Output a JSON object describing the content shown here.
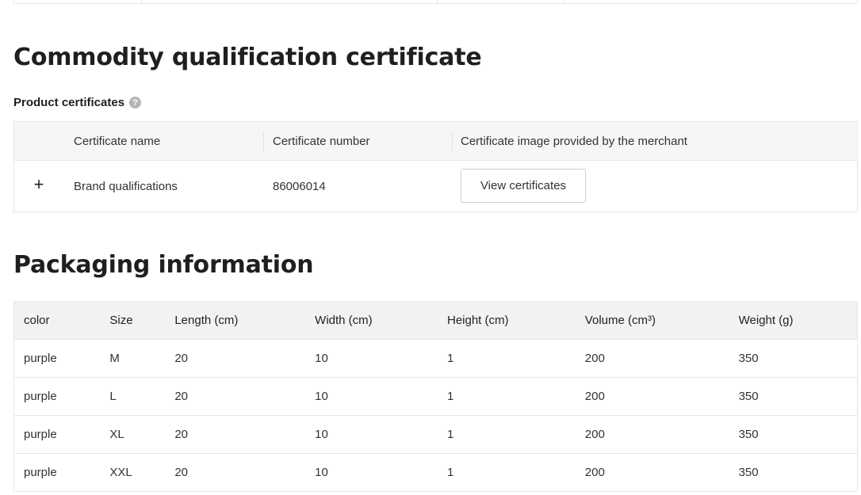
{
  "commodity": {
    "title": "Commodity qualification certificate",
    "subtitle": "Product certificates",
    "help_icon": "?",
    "table": {
      "headers": [
        "Certificate name",
        "Certificate number",
        "Certificate image provided by the merchant"
      ],
      "rows": [
        {
          "name": "Brand qualifications",
          "number": "86006014",
          "button": "View certificates"
        }
      ]
    },
    "expand_icon": "+"
  },
  "packaging": {
    "title": "Packaging information",
    "headers": [
      "color",
      "Size",
      "Length (cm)",
      "Width (cm)",
      "Height (cm)",
      "Volume (cm³)",
      "Weight (g)"
    ],
    "rows": [
      [
        "purple",
        "M",
        "20",
        "10",
        "1",
        "200",
        "350"
      ],
      [
        "purple",
        "L",
        "20",
        "10",
        "1",
        "200",
        "350"
      ],
      [
        "purple",
        "XL",
        "20",
        "10",
        "1",
        "200",
        "350"
      ],
      [
        "purple",
        "XXL",
        "20",
        "10",
        "1",
        "200",
        "350"
      ]
    ]
  }
}
